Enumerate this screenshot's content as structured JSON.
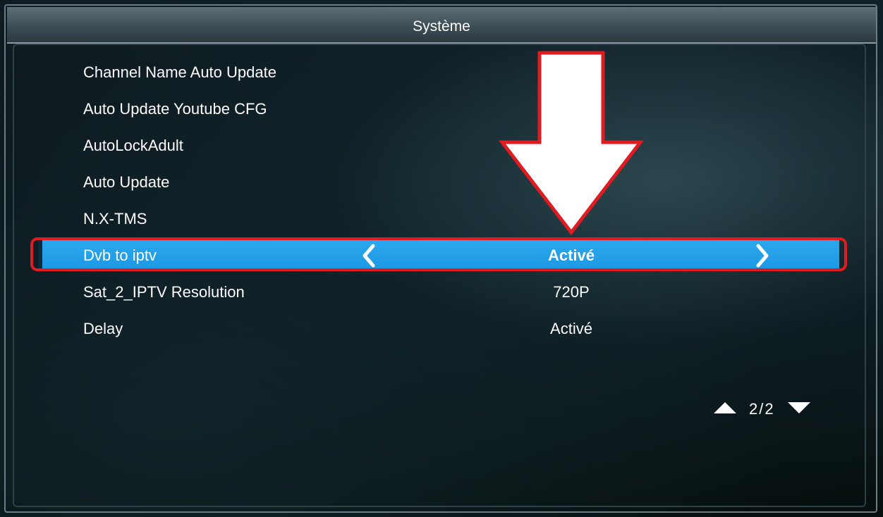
{
  "window": {
    "title": "Système"
  },
  "settings": [
    {
      "label": "Channel Name Auto Update",
      "value": ""
    },
    {
      "label": "Auto Update Youtube CFG",
      "value": ""
    },
    {
      "label": "AutoLockAdult",
      "value": ""
    },
    {
      "label": "Auto Update",
      "value": ""
    },
    {
      "label": "N.X-TMS",
      "value": ""
    },
    {
      "label": "Dvb to iptv",
      "value": "Activé",
      "selected": true
    },
    {
      "label": "Sat_2_IPTV Resolution",
      "value": "720P"
    },
    {
      "label": "Delay",
      "value": "Activé"
    }
  ],
  "pager": {
    "text": "2/2",
    "up_icon": "triangle-up-icon",
    "down_icon": "triangle-down-icon"
  },
  "selector_icons": {
    "left": "chevron-left-icon",
    "right": "chevron-right-icon"
  },
  "annotation": {
    "arrow_icon": "down-arrow-icon",
    "arrow_fill": "#ffffff",
    "outline_color": "#e11b22"
  },
  "colors": {
    "selection": "#1d98e3",
    "text": "#ffffff"
  }
}
